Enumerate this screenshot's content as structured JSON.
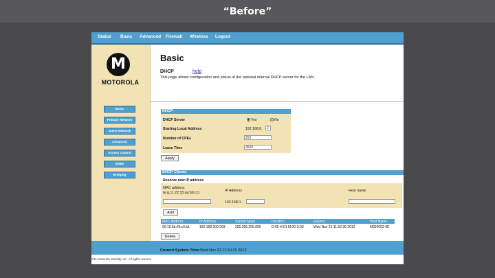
{
  "slide": {
    "title": "“Before”"
  },
  "topnav": [
    "Status",
    "Basic",
    "Advanced",
    "Firewall",
    "Wireless",
    "Logout"
  ],
  "brand": {
    "logo_letter": "M",
    "wordmark": "MOTOROLA"
  },
  "sidebar": [
    "Basic",
    "Primary Network",
    "Guest Network",
    "Advanced",
    "Access Control",
    "WMM",
    "Bridging"
  ],
  "page": {
    "title": "Basic",
    "section": "DHCP",
    "help": "help",
    "description": "This page allows configuration and status of the optional internal DHCP server for the LAN."
  },
  "dhcp": {
    "header": "DHCP",
    "server_label": "DHCP Server",
    "yes": "Yes",
    "no": "No",
    "start_label": "Starting Local Address",
    "start_prefix": "192.168.0.",
    "start_value": "2",
    "cpes_label": "Number of CPEs",
    "cpes_value": "253",
    "lease_label": "Lease Time",
    "lease_value": "3600",
    "apply": "Apply"
  },
  "clients": {
    "header": "DHCP Clients",
    "reserve_title": "Reserve new IP address",
    "mac_label": "MAC address",
    "mac_hint": "(e.g.11:22:33:aa:bb:cc)",
    "ip_label": "IP Address",
    "ip_prefix": "192.168.0.",
    "host_label": "Host name",
    "add": "Add",
    "columns": [
      "MAC Address",
      "IP Address",
      "Subnet Mask",
      "Duration",
      "Expires",
      "Host Name"
    ],
    "row": [
      "00:19:5b:69:c6:b1",
      "192.168.000.003",
      "255.255.255.000",
      "D:00 H:01 M:00 S:00",
      "Wed Nov 21 11:52:36 2012",
      "MGI0063-08"
    ],
    "delete": "Delete"
  },
  "system_time": {
    "label": "Current System Time:",
    "value": "Wed Nov 21 11:10:10 2012"
  },
  "copyright": "©11 Motorola Mobility, Inc. All rights reserve"
}
